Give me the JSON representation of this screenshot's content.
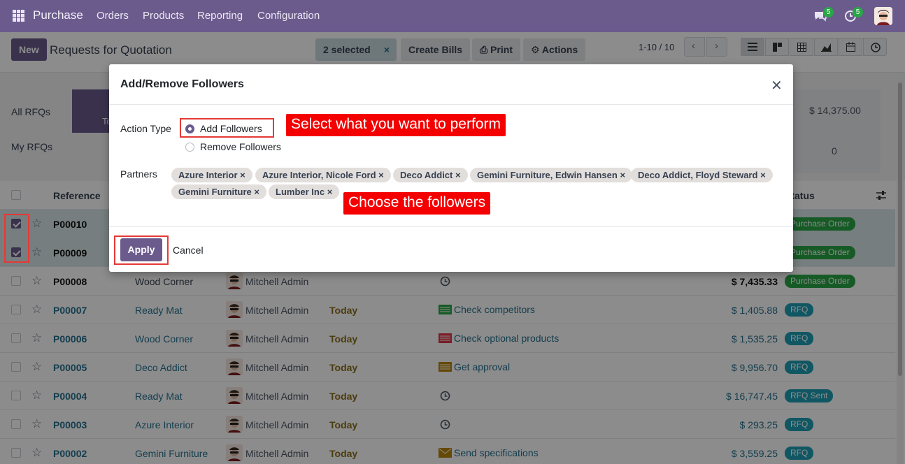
{
  "topbar": {
    "brand": "Purchase",
    "menu": [
      "Orders",
      "Products",
      "Reporting",
      "Configuration"
    ],
    "chat_count": "5",
    "activity_count": "5"
  },
  "control": {
    "new_label": "New",
    "title": "Requests for Quotation",
    "selected": "2 selected",
    "create_bills": "Create Bills",
    "print": "Print",
    "actions": "Actions",
    "pager": "1-10 / 10"
  },
  "summary": {
    "all_rfqs": "All RFQs",
    "my_rfqs": "My RFQs",
    "tab_fragment": "To",
    "amount_total": "$ 14,375.00",
    "count": "0"
  },
  "list": {
    "col_reference": "Reference",
    "col_status": "Status",
    "rows": [
      {
        "ref": "P00010",
        "vendor": "",
        "user": "",
        "date": "",
        "activity": "",
        "amount": "",
        "status": "Purchase Order",
        "selected": true
      },
      {
        "ref": "P00009",
        "vendor": "",
        "user": "",
        "date": "",
        "activity": "",
        "amount": "",
        "status": "Purchase Order",
        "selected": true
      },
      {
        "ref": "P00008",
        "vendor": "Wood Corner",
        "user": "Mitchell Admin",
        "date": "",
        "activity": "",
        "amount": "$ 7,435.33",
        "status": "Purchase Order"
      },
      {
        "ref": "P00007",
        "vendor": "Ready Mat",
        "user": "Mitchell Admin",
        "date": "Today",
        "activity": "Check competitors",
        "amount": "$ 1,405.88",
        "status": "RFQ"
      },
      {
        "ref": "P00006",
        "vendor": "Wood Corner",
        "user": "Mitchell Admin",
        "date": "Today",
        "activity": "Check optional products",
        "amount": "$ 1,535.25",
        "status": "RFQ"
      },
      {
        "ref": "P00005",
        "vendor": "Deco Addict",
        "user": "Mitchell Admin",
        "date": "Today",
        "activity": "Get approval",
        "amount": "$ 9,956.70",
        "status": "RFQ"
      },
      {
        "ref": "P00004",
        "vendor": "Ready Mat",
        "user": "Mitchell Admin",
        "date": "Today",
        "activity": "",
        "amount": "$ 16,747.45",
        "status": "RFQ Sent"
      },
      {
        "ref": "P00003",
        "vendor": "Azure Interior",
        "user": "Mitchell Admin",
        "date": "Today",
        "activity": "",
        "amount": "$ 293.25",
        "status": "RFQ"
      },
      {
        "ref": "P00002",
        "vendor": "Gemini Furniture",
        "user": "Mitchell Admin",
        "date": "Today",
        "activity": "Send specifications",
        "amount": "$ 3,559.25",
        "status": "RFQ"
      }
    ]
  },
  "modal": {
    "title": "Add/Remove Followers",
    "action_type_label": "Action Type",
    "opt_add": "Add Followers",
    "opt_remove": "Remove Followers",
    "partners_label": "Partners",
    "partners": [
      "Azure Interior",
      "Azure Interior, Nicole Ford",
      "Deco Addict",
      "Gemini Furniture, Edwin Hansen",
      "Deco Addict, Floyd Steward",
      "Gemini Furniture",
      "Lumber Inc"
    ],
    "apply": "Apply",
    "cancel": "Cancel"
  },
  "annotations": {
    "callout_action": "Select what you want to perform",
    "callout_followers": "Choose the followers"
  },
  "colors": {
    "brand": "#6b5b8d",
    "annotation": "#f40000",
    "success": "#28a745",
    "info": "#1e9fb4"
  }
}
